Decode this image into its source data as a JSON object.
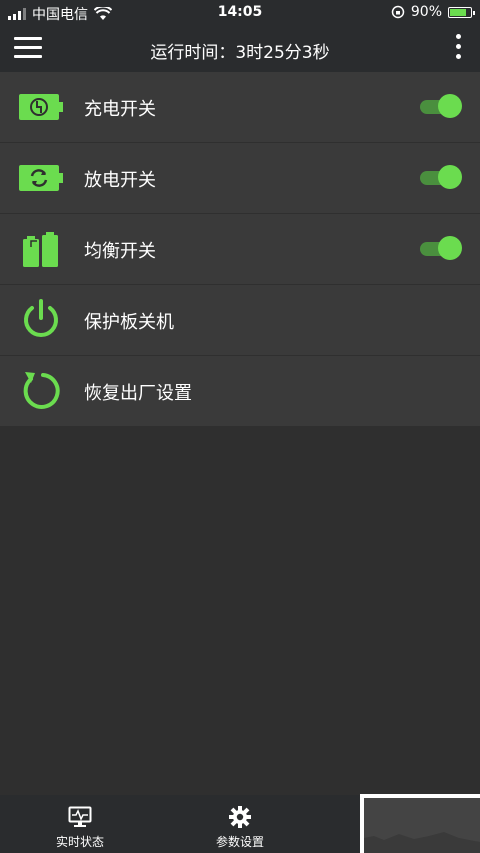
{
  "status_bar": {
    "carrier": "中国电信",
    "time": "14:05",
    "battery_percent": "90%",
    "battery_level": 0.9
  },
  "header": {
    "runtime_label": "运行时间：",
    "runtime_value": "3时25分3秒"
  },
  "settings": [
    {
      "label": "充电开关",
      "icon": "charge-battery-icon",
      "toggle": true
    },
    {
      "label": "放电开关",
      "icon": "discharge-battery-icon",
      "toggle": true
    },
    {
      "label": "均衡开关",
      "icon": "balance-battery-icon",
      "toggle": true
    },
    {
      "label": "保护板关机",
      "icon": "power-icon"
    },
    {
      "label": "恢复出厂设置",
      "icon": "reset-icon"
    }
  ],
  "bottom_nav": [
    {
      "label": "实时状态",
      "icon": "monitor-icon"
    },
    {
      "label": "参数设置",
      "icon": "gear-icon"
    }
  ],
  "colors": {
    "accent": "#6bdc4f",
    "background": "#2f2f2f",
    "row_background": "#3a3a3a",
    "header_background": "#2a2c2e"
  }
}
